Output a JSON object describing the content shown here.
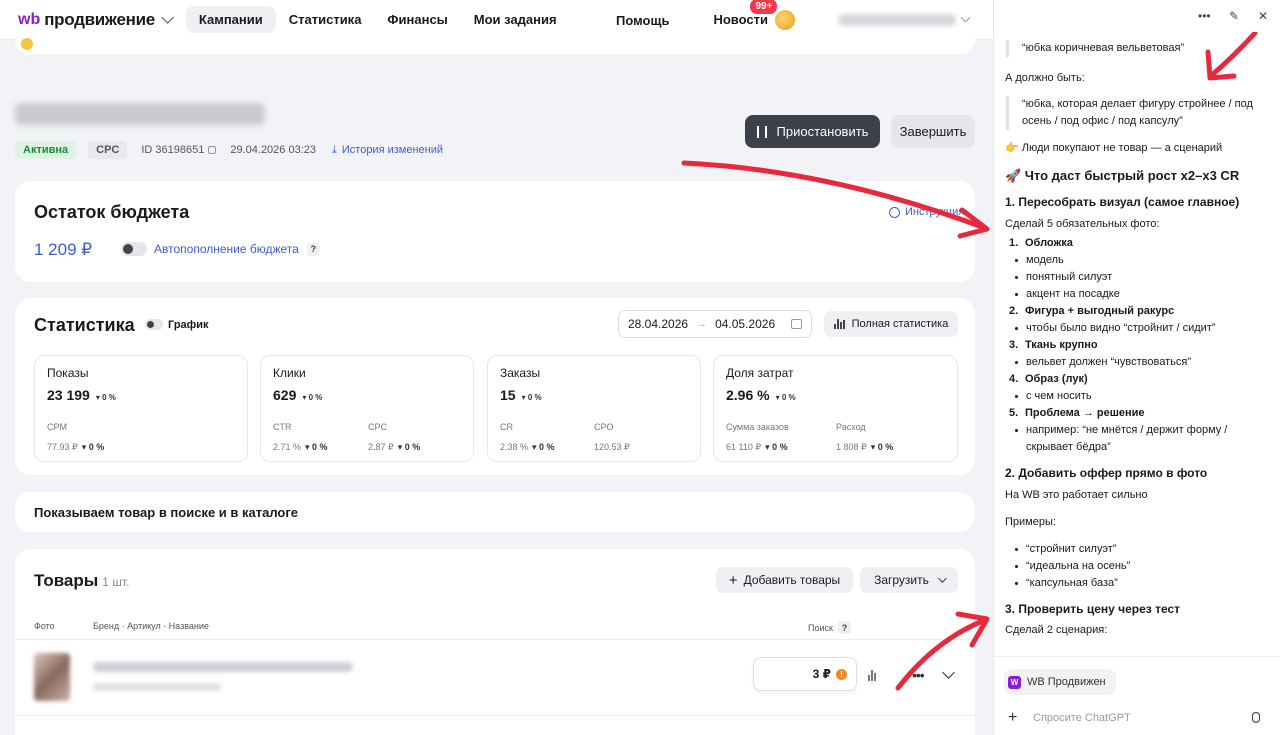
{
  "topbar": {
    "logo_wb": "wb",
    "logo_name": "продвижение",
    "nav": [
      "Кампании",
      "Статистика",
      "Финансы",
      "Мои задания"
    ],
    "help": "Помощь",
    "news": "Новости",
    "news_badge": "99+"
  },
  "campaign": {
    "status": "Активна",
    "type": "CPC",
    "id_text": "ID 36198651",
    "datetime": "29.04.2026 03:23",
    "history": "История изменений",
    "pause_button": "Приостановить",
    "finish_button": "Завершить"
  },
  "budget": {
    "title": "Остаток бюджета",
    "instruction": "Инструкция",
    "amount": "1 209 ₽",
    "autofill": "Автопополнение бюджета",
    "help": "?"
  },
  "stats": {
    "title": "Статистика",
    "graph_label": "График",
    "date_from": "28.04.2026",
    "date_to": "04.05.2026",
    "arrow": "→",
    "full_button": "Полная статистика",
    "metrics": [
      {
        "title": "Показы",
        "value": "23 199",
        "change": "▾ 0 %",
        "sub": [
          {
            "label": "CPM",
            "value": "77.93 ₽",
            "change": "▾ 0 %"
          }
        ]
      },
      {
        "title": "Клики",
        "value": "629",
        "change": "▾ 0 %",
        "sub": [
          {
            "label": "CTR",
            "value": "2.71 %",
            "change": "▾ 0 %"
          },
          {
            "label": "CPC",
            "value": "2.87 ₽",
            "change": "▾ 0 %"
          }
        ]
      },
      {
        "title": "Заказы",
        "value": "15",
        "change": "▾ 0 %",
        "sub": [
          {
            "label": "CR",
            "value": "2.38 %",
            "change": "▾ 0 %"
          },
          {
            "label": "CPO",
            "value": "120.53 ₽",
            "change": ""
          }
        ]
      },
      {
        "title": "Доля затрат",
        "value": "2.96 %",
        "change": "▾ 0 %",
        "sub": [
          {
            "label": "Сумма заказов",
            "value": "61 110 ₽",
            "change": "▾ 0 %"
          },
          {
            "label": "Расход",
            "value": "1 808 ₽",
            "change": "▾ 0 %"
          }
        ]
      }
    ]
  },
  "show": {
    "title": "Показываем товар в поиске и в каталоге"
  },
  "goods": {
    "title": "Товары",
    "count": "1 шт.",
    "add_button": "Добавить товары",
    "load_button": "Загрузить",
    "col_photo": "Фото",
    "col_name": "Бренд · Артикул · Название",
    "col_search": "Поиск",
    "help": "?",
    "price": "3 ₽",
    "warn": "!"
  },
  "chat": {
    "quote1": "“юбка коричневая вельветовая”",
    "should_be": "А должно быть:",
    "quote2": "“юбка, которая делает фигуру стройнее / под осень / под офис / под капсулу”",
    "scenario": "👉 Люди покупают не товар — а сценарий",
    "heading": "🚀 Что даст быстрый рост х2–х3 CR",
    "s1": "1. Пересобрать визуал (самое главное)",
    "s1_intro": "Сделай 5 обязательных фото:",
    "items": [
      {
        "n": "1.",
        "t": "Обложка",
        "b": [
          "модель",
          "понятный силуэт",
          "акцент на посадке"
        ]
      },
      {
        "n": "2.",
        "t": "Фигура + выгодный ракурс",
        "b": [
          "чтобы было видно “стройнит / сидит”"
        ]
      },
      {
        "n": "3.",
        "t": "Ткань крупно",
        "b": [
          "вельвет должен “чувствоваться”"
        ]
      },
      {
        "n": "4.",
        "t": "Образ (лук)",
        "b": [
          "с чем носить"
        ]
      },
      {
        "n": "5.",
        "t": "Проблема → решение",
        "b": [
          "например: “не мнётся / держит форму / скрывает бёдра”"
        ]
      }
    ],
    "s2": "2. Добавить оффер прямо в фото",
    "s2_text": "На WB это работает сильно",
    "examples": "Примеры:",
    "ex": [
      "“стройнит силуэт”",
      "“идеальна на осень”",
      "“капсульная база”"
    ],
    "s3": "3. Проверить цену через тест",
    "s3_text": "Сделай 2 сценария:",
    "chip": "WB Продвижен",
    "ask_placeholder": "Спросите ChatGPT"
  },
  "colors": {
    "accent": "#3e5bd6",
    "brand": "#8a1bd6",
    "arrow": "#e8283c"
  }
}
